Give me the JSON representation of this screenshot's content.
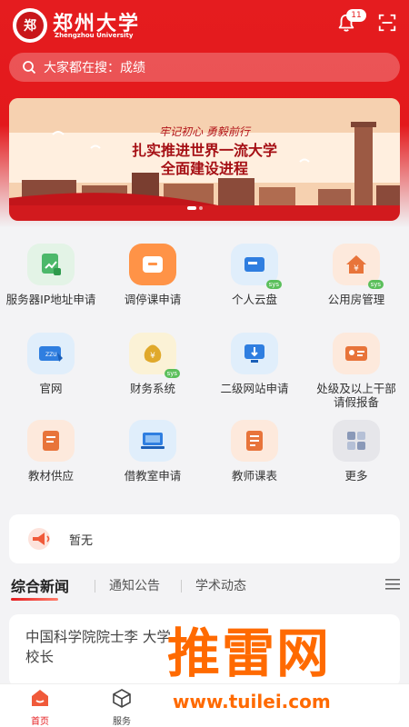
{
  "header": {
    "logo_cn": "郑州大学",
    "logo_en": "Zhengzhou University",
    "emblem_text": "郑",
    "notification_count": "11"
  },
  "search": {
    "placeholder": "大家都在搜：成绩"
  },
  "banner": {
    "line1": "牢记初心 勇毅前行",
    "line2": "扎实推进世界一流大学",
    "line3": "全面建设进程"
  },
  "services": [
    {
      "label": "服务器IP地址申请",
      "icon": "server-ip-icon",
      "color": "green"
    },
    {
      "label": "调停课申请",
      "icon": "course-adjust-icon",
      "color": "orange"
    },
    {
      "label": "个人云盘",
      "icon": "cloud-disk-icon",
      "color": "blue",
      "badge": "sys"
    },
    {
      "label": "公用房管理",
      "icon": "house-yen-icon",
      "color": "peach",
      "badge": "sys"
    },
    {
      "label": "官网",
      "icon": "website-icon",
      "color": "blue",
      "chip": "ZZU"
    },
    {
      "label": "财务系统",
      "icon": "finance-icon",
      "color": "yellow",
      "badge": "sys"
    },
    {
      "label": "二级网站申请",
      "icon": "usb-site-icon",
      "color": "blue"
    },
    {
      "label": "处级及以上干部请假报备",
      "icon": "leave-report-icon",
      "color": "peach"
    },
    {
      "label": "教材供应",
      "icon": "textbook-icon",
      "color": "peach"
    },
    {
      "label": "借教室申请",
      "icon": "classroom-icon",
      "color": "blue"
    },
    {
      "label": "教师课表",
      "icon": "teacher-schedule-icon",
      "color": "peach"
    },
    {
      "label": "更多",
      "icon": "more-grid-icon",
      "color": "gray"
    }
  ],
  "notice": {
    "text": "暂无"
  },
  "news_tabs": [
    {
      "label": "综合新闻",
      "active": true
    },
    {
      "label": "通知公告",
      "active": false
    },
    {
      "label": "学术动态",
      "active": false
    }
  ],
  "news": {
    "headline": "中国科学院院士李 大学校长"
  },
  "watermark": {
    "main": "推雷网",
    "url": "www.tuilei.com"
  },
  "bottom_nav": [
    {
      "label": "首页",
      "active": true
    },
    {
      "label": "服务",
      "active": false
    }
  ],
  "colors": {
    "brand": "#e51c1f",
    "accent": "#ff9347"
  }
}
